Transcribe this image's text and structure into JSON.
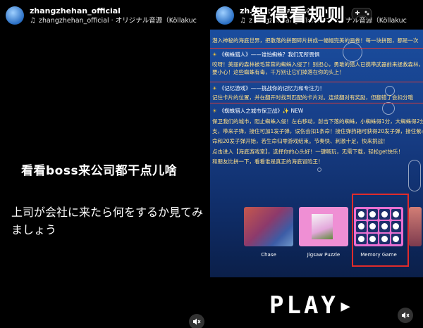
{
  "left_post": {
    "username": "zhangzhehan_official",
    "audio_label": "zhangzhehan_official · オリジナル音源（Köllakuc",
    "caption_cn": "看看boss来公司都干点儿啥",
    "caption_jp": "上司が会社に来たら何をするか見てみましょう"
  },
  "right_post": {
    "username": "zhangzhehan_official",
    "audio_label": "zhangzhehan_official · オリジナル音源（Köllakuc",
    "overlay_title": "智得看规则",
    "sections": [
      {
        "lines": [
          "潜入神秘的海底世界，把散落的拼图碎片拼成一幅幅完美的画卷！每一块拼图，都是一次"
        ]
      },
      {
        "title": "《蜘蛛猎人》——谁怕蜘蛛？我们无所畏惧",
        "lines": [
          "咬呀！美丽的森林被毛茸茸的蜘蛛入侵了！别担心，勇敢的猎人已携带武器前来拯救森林，",
          "要小心！这些蜘蛛有毒，千万别让它们掉落在你的头上！"
        ]
      },
      {
        "title": "《记忆游戏》——挑战你的记忆力和专注力！",
        "lines": [
          "记住卡片的位置，并在翻开时找到匹配的卡片对。连续翻对有奖励，但翻错了会扣分哦"
        ]
      },
      {
        "title": "《蜘蛛猎人之城市保卫战》✨ NEW",
        "lines": [
          "保卫我们的城市，阻止蜘蛛入侵！左右移动，射击下落的蜘蛛，小蜘蛛得1分，大蜘蛛得2分",
          "支，带来子弹，接住可加1发子弹，误伤会扣1条命！接住弹药箱可获得20发子弹，接住紫心",
          "命和20发子弹开始，若生命归零游戏结束。节奏快、刺激十足，快来挑战！"
        ]
      },
      {
        "lines": [
          "点击进入【海底游戏室】，选择你的心头好！一键畅玩，无需下载，轻松get快乐！",
          "和朋友比拼一下，看看谁是真正的海底冒险王！"
        ]
      }
    ],
    "games": [
      {
        "label": "Chase"
      },
      {
        "label": "Jigsaw Puzzle"
      },
      {
        "label": "Memory Game"
      }
    ],
    "play_text": "PLAY▸"
  },
  "icons": {
    "music": "music-note-icon",
    "mute": "speaker-muted-icon",
    "gamepad": "gamepad-icon",
    "sun": "sun-icon",
    "sparkle": "sparkle-icon"
  },
  "colors": {
    "screen_bg": "#173e87",
    "highlight_border": "#e02b2b",
    "section_text": "#ffe089"
  }
}
